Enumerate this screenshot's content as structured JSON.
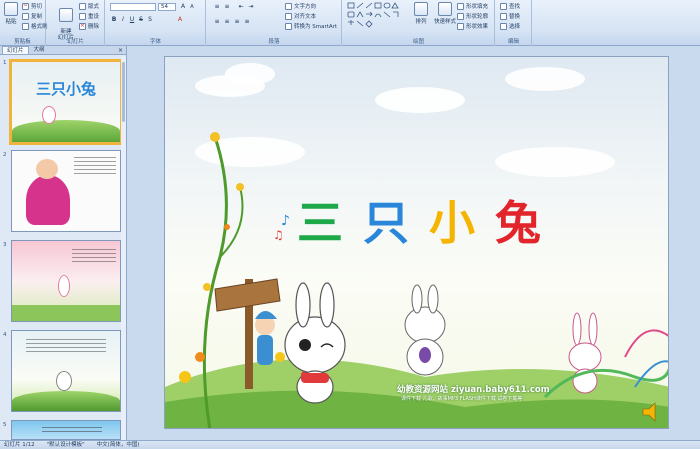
{
  "ribbon": {
    "clipboard": {
      "label": "剪贴板",
      "paste": "粘贴",
      "cut": "剪切",
      "copy": "复制",
      "format_painter": "格式刷"
    },
    "slides": {
      "label": "幻灯片",
      "new_slide": "新建\n幻灯片",
      "layout": "版式",
      "reset": "重设",
      "delete": "删除"
    },
    "font": {
      "label": "字体",
      "font_name": "",
      "font_size": "54"
    },
    "paragraph": {
      "label": "段落",
      "text_direction": "文字方向",
      "align_text": "对齐文本",
      "smartart": "转换为 SmartArt"
    },
    "drawing": {
      "label": "绘图",
      "arrange": "排列",
      "quick_styles": "快速样式",
      "shape_fill": "形状填充",
      "shape_outline": "形状轮廓",
      "shape_effects": "形状效果"
    },
    "editing": {
      "label": "编辑",
      "find": "查找",
      "replace": "替换",
      "select": "选择"
    }
  },
  "panel": {
    "tab_slides": "幻灯片",
    "tab_outline": "大纲",
    "close": "×",
    "thumbnails": [
      {
        "num": "1",
        "title": "三只小兔"
      },
      {
        "num": "2"
      },
      {
        "num": "3"
      },
      {
        "num": "4"
      },
      {
        "num": "5"
      }
    ]
  },
  "slide": {
    "title_chars": [
      "三",
      "只",
      "小",
      "兔"
    ],
    "site_text": "幼教资源网站 ziyuan.baby611.com",
    "site_sub": "课件下载  儿歌、故事MP3  FLASH课件下载  试卷下载等",
    "colors": {
      "c1": "#1fa84a",
      "c2": "#2a86d9",
      "c3": "#f5b400",
      "c4": "#e2242b"
    }
  },
  "status": {
    "slide_count": "幻灯片 1/12",
    "theme": "\"默认设计模板\"",
    "language": "中文(简体，中国)"
  }
}
